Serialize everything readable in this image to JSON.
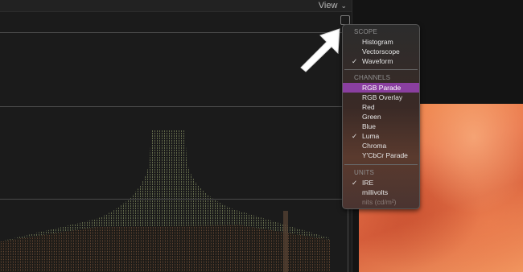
{
  "header": {
    "view_label": "View",
    "view_chevron": "⌄"
  },
  "menu": {
    "sections": [
      {
        "title": "SCOPE",
        "items": [
          {
            "label": "Histogram",
            "checked": false
          },
          {
            "label": "Vectorscope",
            "checked": false
          },
          {
            "label": "Waveform",
            "checked": true
          }
        ]
      },
      {
        "title": "CHANNELS",
        "items": [
          {
            "label": "RGB Parade",
            "checked": false,
            "highlighted": true
          },
          {
            "label": "RGB Overlay",
            "checked": false
          },
          {
            "label": "Red",
            "checked": false
          },
          {
            "label": "Green",
            "checked": false
          },
          {
            "label": "Blue",
            "checked": false
          },
          {
            "label": "Luma",
            "checked": true
          },
          {
            "label": "Chroma",
            "checked": false
          },
          {
            "label": "Y'CbCr Parade",
            "checked": false
          }
        ]
      },
      {
        "title": "UNITS",
        "items": [
          {
            "label": "IRE",
            "checked": true
          },
          {
            "label": "millivolts",
            "checked": false
          },
          {
            "label": "nits (cd/m²)",
            "checked": false,
            "disabled": true
          }
        ]
      }
    ],
    "check_glyph": "✓"
  },
  "icons": {
    "scope_settings": "scope-settings-icon",
    "annotation_arrow": "arrow-icon"
  },
  "colors": {
    "menu_highlight": "#8a3fa0",
    "waveform_green": "#7a8a5a",
    "waveform_orange": "#8a5a3a"
  }
}
